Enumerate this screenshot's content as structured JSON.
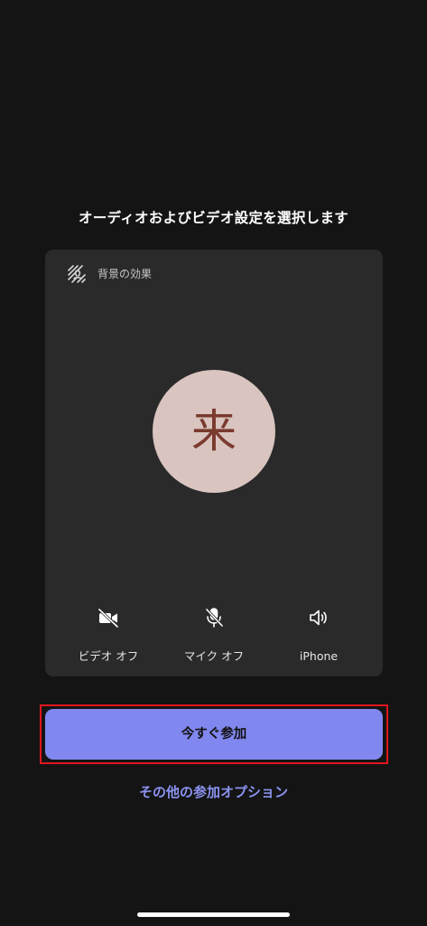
{
  "header": {
    "title": "オーディオおよびビデオ設定を選択します"
  },
  "preview": {
    "background_effects_label": "背景の効果",
    "background_effects_icon": "background-effects-icon",
    "avatar_initial": "来",
    "avatar_color": "#d9c4bf",
    "avatar_text_color": "#7a3a2e"
  },
  "controls": {
    "video": {
      "label": "ビデオ オフ",
      "icon": "video-off-icon"
    },
    "mic": {
      "label": "マイク オフ",
      "icon": "mic-off-icon"
    },
    "audio": {
      "label": "iPhone",
      "icon": "speaker-icon"
    }
  },
  "actions": {
    "join_now_label": "今すぐ参加",
    "more_options_label": "その他の参加オプション"
  },
  "colors": {
    "background": "#141414",
    "card": "#2a2a2a",
    "accent": "#8087ee",
    "link": "#8b93f0",
    "highlight": "#e0161f"
  }
}
